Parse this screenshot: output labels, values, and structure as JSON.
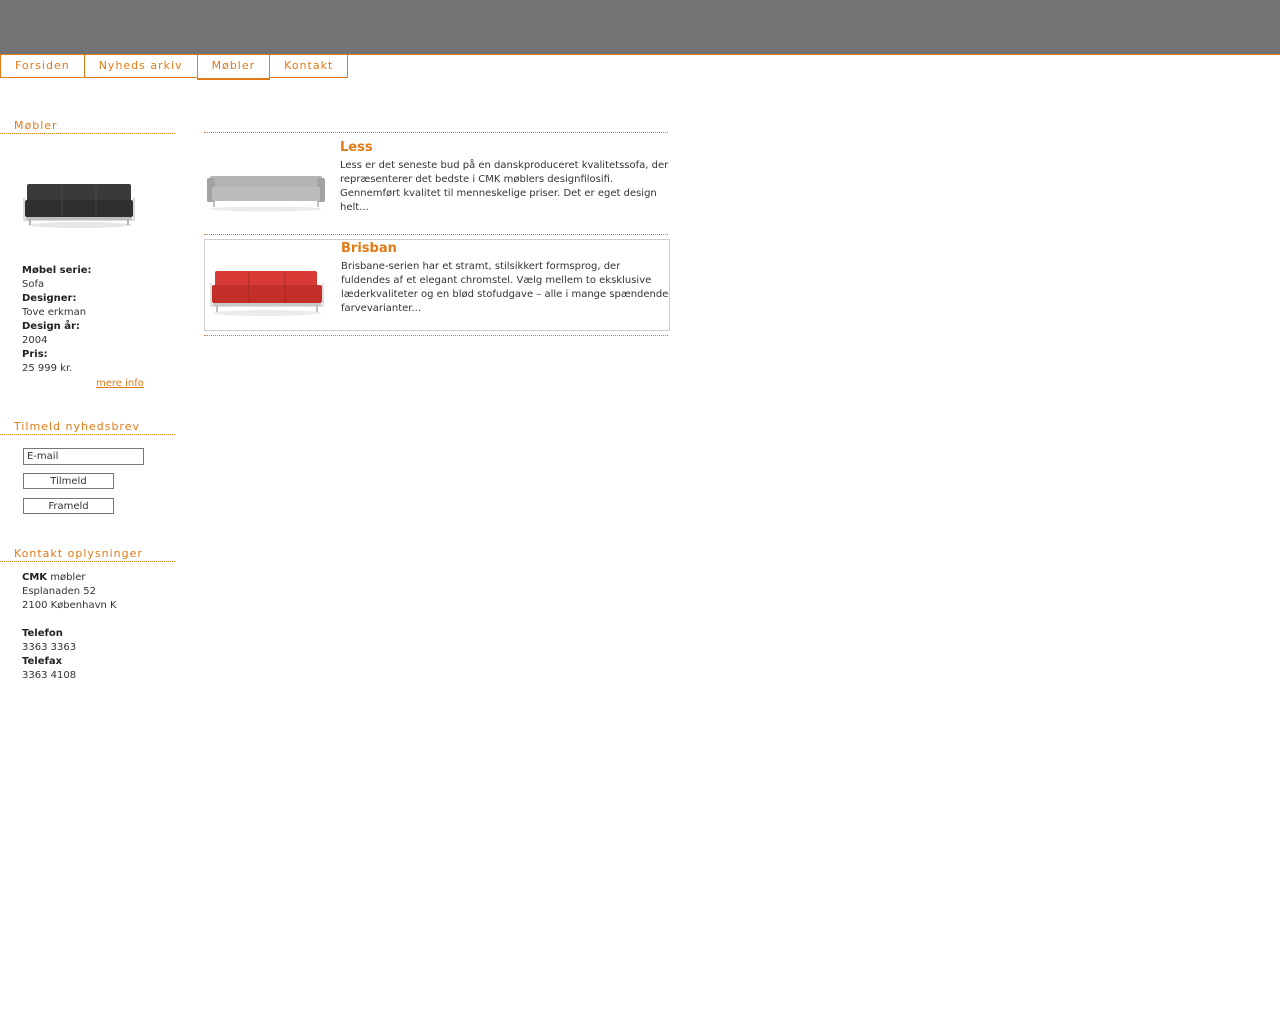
{
  "nav": {
    "tabs": [
      {
        "label": "Forsiden",
        "active": false
      },
      {
        "label": "Nyheds arkiv",
        "active": false
      },
      {
        "label": "Møbler",
        "active": true
      },
      {
        "label": "Kontakt",
        "active": false
      }
    ]
  },
  "sidebar": {
    "moebler": {
      "title": "Møbler",
      "serie_label": "Møbel serie:",
      "serie_value": "Sofa",
      "designer_label": "Designer:",
      "designer_value": "Tove erkman",
      "year_label": "Design år:",
      "year_value": "2004",
      "price_label": "Pris:",
      "price_value": "25 999 kr.",
      "more_link": "mere info"
    },
    "newsletter": {
      "title": "Tilmeld nyhedsbrev",
      "email_value": "E-mail",
      "subscribe_label": "Tilmeld",
      "unsubscribe_label": "Frameld"
    },
    "contact": {
      "title": "Kontakt oplysninger",
      "company_bold": "CMK",
      "company_rest": " møbler",
      "street": "Esplanaden 52",
      "city": "2100 København K",
      "phone_label": "Telefon",
      "phone_value": "3363 3363",
      "fax_label": "Telefax",
      "fax_value": "3363 4108"
    }
  },
  "products": [
    {
      "name": "Less",
      "description": "Less er det seneste bud på en danskproduceret kvalitetssofa, der repræsenterer det bedste i CMK møblers designfilosifi. Gennemført kvalitet til menneskelige priser. Det er eget design helt...",
      "sofa_color": "#a9a9a9"
    },
    {
      "name": "Brisban",
      "description": "Brisbane-serien har et stramt, stilsikkert formsprog, der fuldendes af et elegant chromstel. Vælg mellem to eksklusive læderkvaliteter og en blød stofudgave – alle i mange spændende farvevarianter...",
      "sofa_color": "#c7302c"
    }
  ],
  "colors": {
    "accent": "#e07b16",
    "header_bg": "#737373"
  }
}
